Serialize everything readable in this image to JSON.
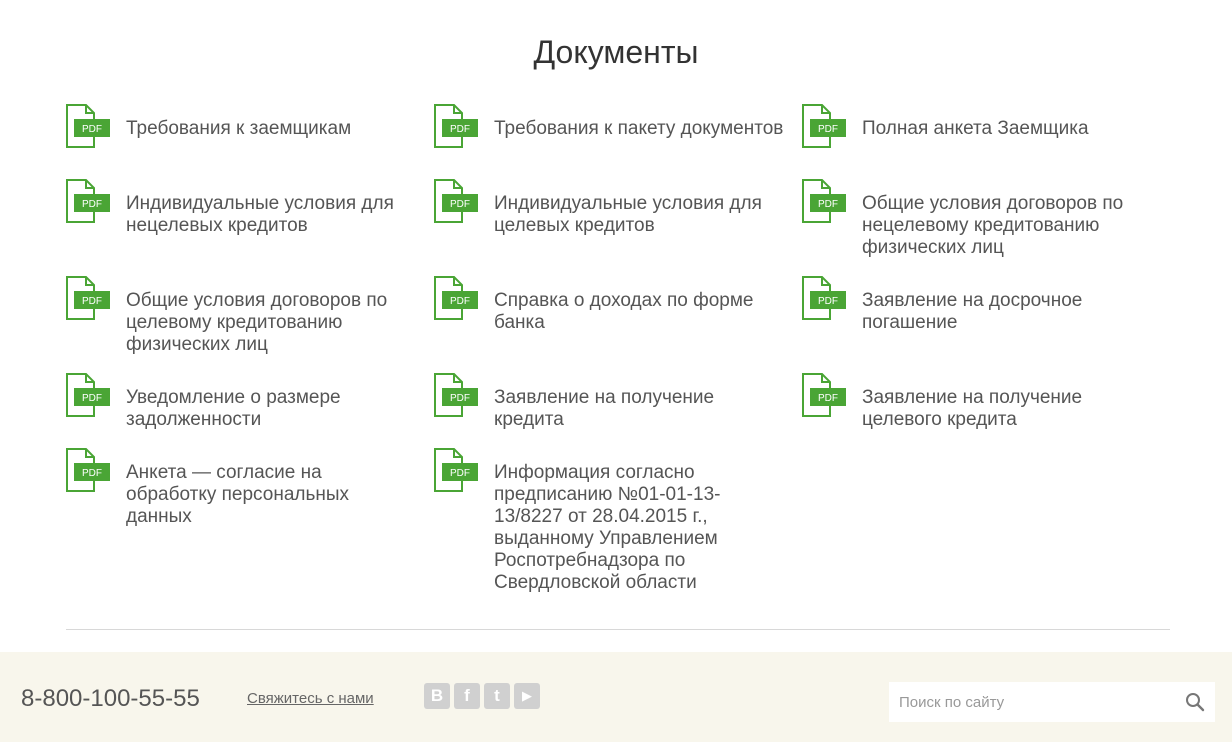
{
  "page": {
    "title": "Документы"
  },
  "documents": [
    {
      "label": "Требования к заемщикам",
      "icon": "pdf-icon",
      "icon_text": "PDF"
    },
    {
      "label": "Требования к пакету документов",
      "icon": "pdf-icon",
      "icon_text": "PDF"
    },
    {
      "label": "Полная анкета Заемщика",
      "icon": "pdf-icon",
      "icon_text": "PDF"
    },
    {
      "label": "Индивидуальные условия для нецелевых кредитов",
      "icon": "pdf-icon",
      "icon_text": "PDF"
    },
    {
      "label": "Индивидуальные условия для целевых кредитов",
      "icon": "pdf-icon",
      "icon_text": "PDF"
    },
    {
      "label": "Общие условия договоров по нецелевому кредитованию физических лиц",
      "icon": "pdf-icon",
      "icon_text": "PDF"
    },
    {
      "label": "Общие условия договоров по целевому кредитованию физических лиц",
      "icon": "pdf-icon",
      "icon_text": "PDF"
    },
    {
      "label": "Справка о доходах по форме банка",
      "icon": "pdf-icon",
      "icon_text": "PDF"
    },
    {
      "label": "Заявление на досрочное погашение",
      "icon": "pdf-icon",
      "icon_text": "PDF"
    },
    {
      "label": "Уведомление о размере задолженности",
      "icon": "pdf-icon",
      "icon_text": "PDF"
    },
    {
      "label": "Заявление на получение кредита",
      "icon": "pdf-icon",
      "icon_text": "PDF"
    },
    {
      "label": "Заявление на получение целевого кредита",
      "icon": "pdf-icon",
      "icon_text": "PDF"
    },
    {
      "label": "Анкета — согласие на обработку персональных данных",
      "icon": "pdf-icon",
      "icon_text": "PDF"
    },
    {
      "label": "Информация согласно предписанию №01-01-13-13/8227 от 28.04.2015 г., выданному Управлением Роспотребнадзора по Свердловской области",
      "icon": "pdf-icon",
      "icon_text": "PDF"
    }
  ],
  "footer": {
    "phone": "8-800-100-55-55",
    "contact_link": "Свяжитесь с нами",
    "social": [
      {
        "icon": "vk-icon",
        "glyph": "B"
      },
      {
        "icon": "facebook-icon",
        "glyph": "f"
      },
      {
        "icon": "twitter-icon",
        "glyph": "t"
      },
      {
        "icon": "youtube-icon",
        "glyph": "▶"
      }
    ],
    "search": {
      "placeholder": "Поиск по сайту",
      "icon": "search-icon"
    }
  },
  "colors": {
    "accent_green": "#4aa535",
    "footer_bg": "#f8f6ec",
    "text": "#555555",
    "title": "#333333"
  }
}
